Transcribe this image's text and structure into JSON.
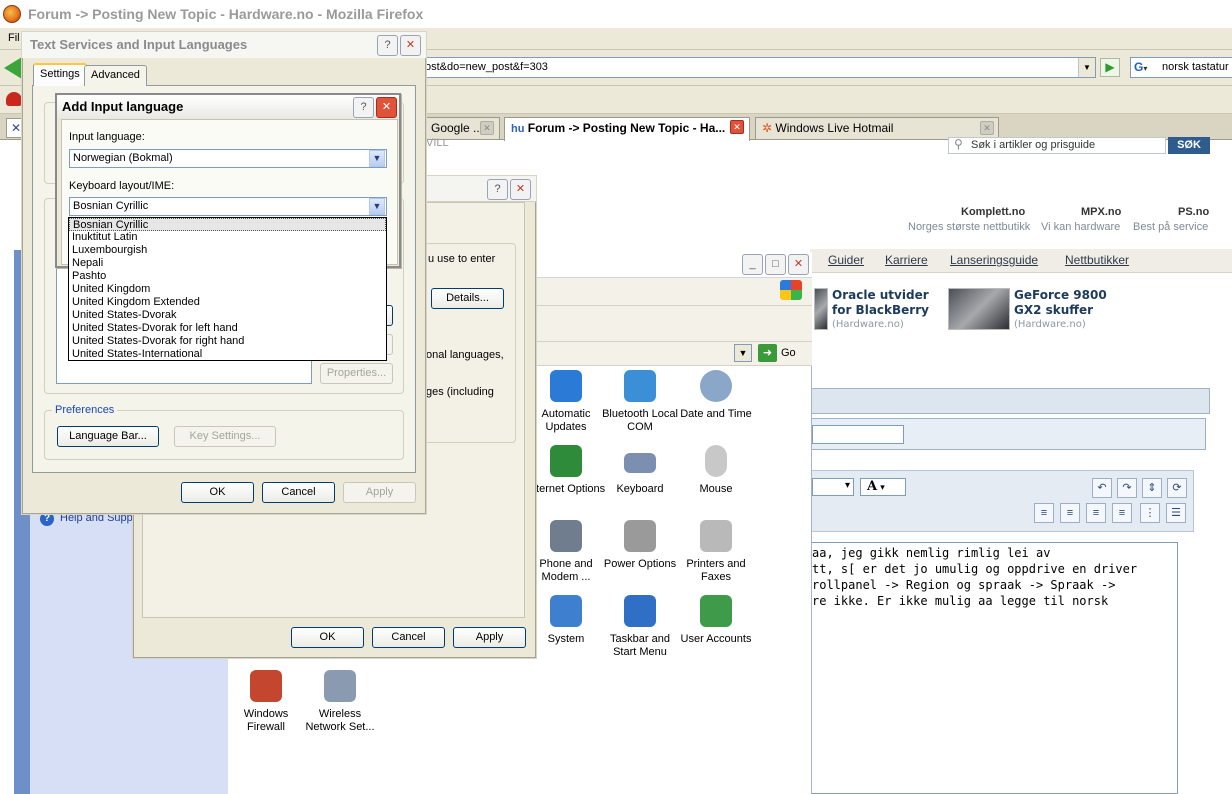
{
  "firefox": {
    "title": "Forum -> Posting New Topic - Hardware.no - Mozilla Firefox",
    "menu_first": "Fil",
    "url": "ost&do=new_post&f=303",
    "go_symbol": "▶",
    "search_engine": "G",
    "search_text": "norsk tastatur",
    "tabs": [
      {
        "label": "Google ...",
        "active": false
      },
      {
        "label": "Forum -> Posting New Topic - Ha...",
        "active": true
      },
      {
        "label": "Windows Live Hotmail",
        "active": false
      }
    ]
  },
  "site": {
    "header_fragment": "VILL",
    "search_placeholder": "Søk i artikler og prisguide",
    "search_button": "SØK",
    "partners": [
      {
        "name": "Komplett.no",
        "sub": "Norges største nettbutikk"
      },
      {
        "name": "MPX.no",
        "sub": "Vi kan hardware"
      },
      {
        "name": "PS.no",
        "sub": "Best på service"
      }
    ],
    "nav": [
      "Guider",
      "Karriere",
      "Lanseringsguide",
      "Nettbutikker"
    ],
    "news": [
      {
        "title_line1": "Oracle utvider",
        "title_line2": "for BlackBerry",
        "source": "(Hardware.no)"
      },
      {
        "title_line1": "GeForce 9800",
        "title_line2": "GX2 skuffer",
        "source": "(Hardware.no)"
      }
    ],
    "font_button": "A",
    "post_lines": [
      "aa, jeg gikk nemlig rimlig lei av",
      "tt, s[ er det jo umulig og oppdrive en driver",
      "rollpanel -> Region og spraak -> Spraak ->",
      "re ikke. Er ikke mulig aa legge til norsk"
    ]
  },
  "control_panel": {
    "help_text": "Help and Support",
    "go_label": "Go",
    "icons": [
      {
        "label": "Automatic Updates",
        "icon": "automatic-updates-icon",
        "color": "#2b7bd6"
      },
      {
        "label": "Bluetooth Local COM",
        "icon": "bluetooth-icon",
        "color": "#3a8fd6"
      },
      {
        "label": "Date and Time",
        "icon": "clock-icon",
        "color": "#8aa6c9"
      },
      {
        "label": "Internet Options",
        "icon": "internet-options-icon",
        "color": "#2e8b3a"
      },
      {
        "label": "Keyboard",
        "icon": "keyboard-icon",
        "color": "#7c8fb0"
      },
      {
        "label": "Mouse",
        "icon": "mouse-icon",
        "color": "#c8c8c8"
      },
      {
        "label": "Phone and Modem ...",
        "icon": "phone-icon",
        "color": "#6f7d8f"
      },
      {
        "label": "Power Options",
        "icon": "power-options-icon",
        "color": "#9a9a9a"
      },
      {
        "label": "Printers and Faxes",
        "icon": "printer-icon",
        "color": "#b9b9b9"
      },
      {
        "label": "System",
        "icon": "system-icon",
        "color": "#3f7fd0"
      },
      {
        "label": "Taskbar and Start Menu",
        "icon": "taskbar-icon",
        "color": "#2f6fc6"
      },
      {
        "label": "User Accounts",
        "icon": "user-accounts-icon",
        "color": "#3f9a4a"
      },
      {
        "label": "Windows Firewall",
        "icon": "firewall-icon",
        "color": "#c5462f"
      },
      {
        "label": "Wireless Network Set...",
        "icon": "wireless-icon",
        "color": "#8a9ab0"
      }
    ]
  },
  "regional_dialog": {
    "text1": "u use to enter",
    "details_button": "Details...",
    "text2": "onal languages,",
    "text3": "ges (including",
    "ok": "OK",
    "cancel": "Cancel",
    "apply": "Apply"
  },
  "text_services": {
    "title": "Text Services and Input Languages",
    "tabs": [
      "Settings",
      "Advanced"
    ],
    "properties_button": "Properties...",
    "preferences_label": "Preferences",
    "language_bar_button": "Language Bar...",
    "key_settings_button": "Key Settings...",
    "ok": "OK",
    "cancel": "Cancel",
    "apply": "Apply"
  },
  "add_input_language": {
    "title": "Add Input language",
    "input_language_label": "Input language:",
    "input_language_value": "Norwegian (Bokmal)",
    "keyboard_layout_label": "Keyboard layout/IME:",
    "keyboard_layout_value": "Bosnian Cyrillic",
    "options": [
      "Bosnian Cyrillic",
      "Inuktitut Latin",
      "Luxembourgish",
      "Nepali",
      "Pashto",
      "United Kingdom",
      "United Kingdom Extended",
      "United States-Dvorak",
      "United States-Dvorak for left hand",
      "United States-Dvorak for right hand",
      "United States-International"
    ],
    "selected_index": 0
  }
}
